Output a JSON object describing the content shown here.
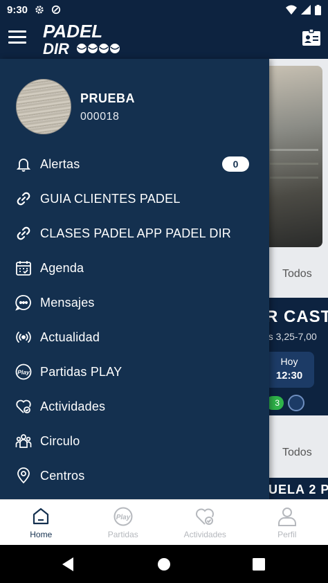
{
  "status_bar": {
    "time": "9:30"
  },
  "app_bar": {
    "logo_line1": "PADEL",
    "logo_line2": "DIR"
  },
  "background": {
    "todos_label_1": "Todos",
    "todos_label_2": "Todos",
    "card_title": "R CAST",
    "card_subtitle": "es 3,25-7,00",
    "day_label": "Hoy",
    "time_label": "12:30",
    "pill_value": "3",
    "card2_title": "UELA 2 P"
  },
  "drawer": {
    "user_name": "PRUEBA",
    "user_id": "000018",
    "items": [
      {
        "label": "Alertas",
        "icon": "bell-icon",
        "badge": "0"
      },
      {
        "label": "GUIA CLIENTES PADEL",
        "icon": "link-icon"
      },
      {
        "label": "CLASES PADEL APP PADEL DIR",
        "icon": "link-icon"
      },
      {
        "label": "Agenda",
        "icon": "calendar-icon"
      },
      {
        "label": "Mensajes",
        "icon": "chat-icon"
      },
      {
        "label": "Actualidad",
        "icon": "broadcast-icon"
      },
      {
        "label": "Partidas PLAY",
        "icon": "play-badge-icon"
      },
      {
        "label": "Actividades",
        "icon": "heart-check-icon"
      },
      {
        "label": "Circulo",
        "icon": "group-icon"
      },
      {
        "label": "Centros",
        "icon": "location-pin-icon"
      }
    ]
  },
  "bottom_nav": {
    "tabs": [
      {
        "label": "Home",
        "icon": "home-icon",
        "active": true
      },
      {
        "label": "Partidas",
        "icon": "play-badge-icon",
        "active": false
      },
      {
        "label": "Actividades",
        "icon": "heart-check-icon",
        "active": false
      },
      {
        "label": "Perfil",
        "icon": "person-icon",
        "active": false
      }
    ]
  },
  "colors": {
    "primary": "#0d2340",
    "drawer": "#14304f",
    "nav_active": "#14304f",
    "nav_inactive": "#b5b8bd",
    "pill_green": "#2fb34a"
  }
}
